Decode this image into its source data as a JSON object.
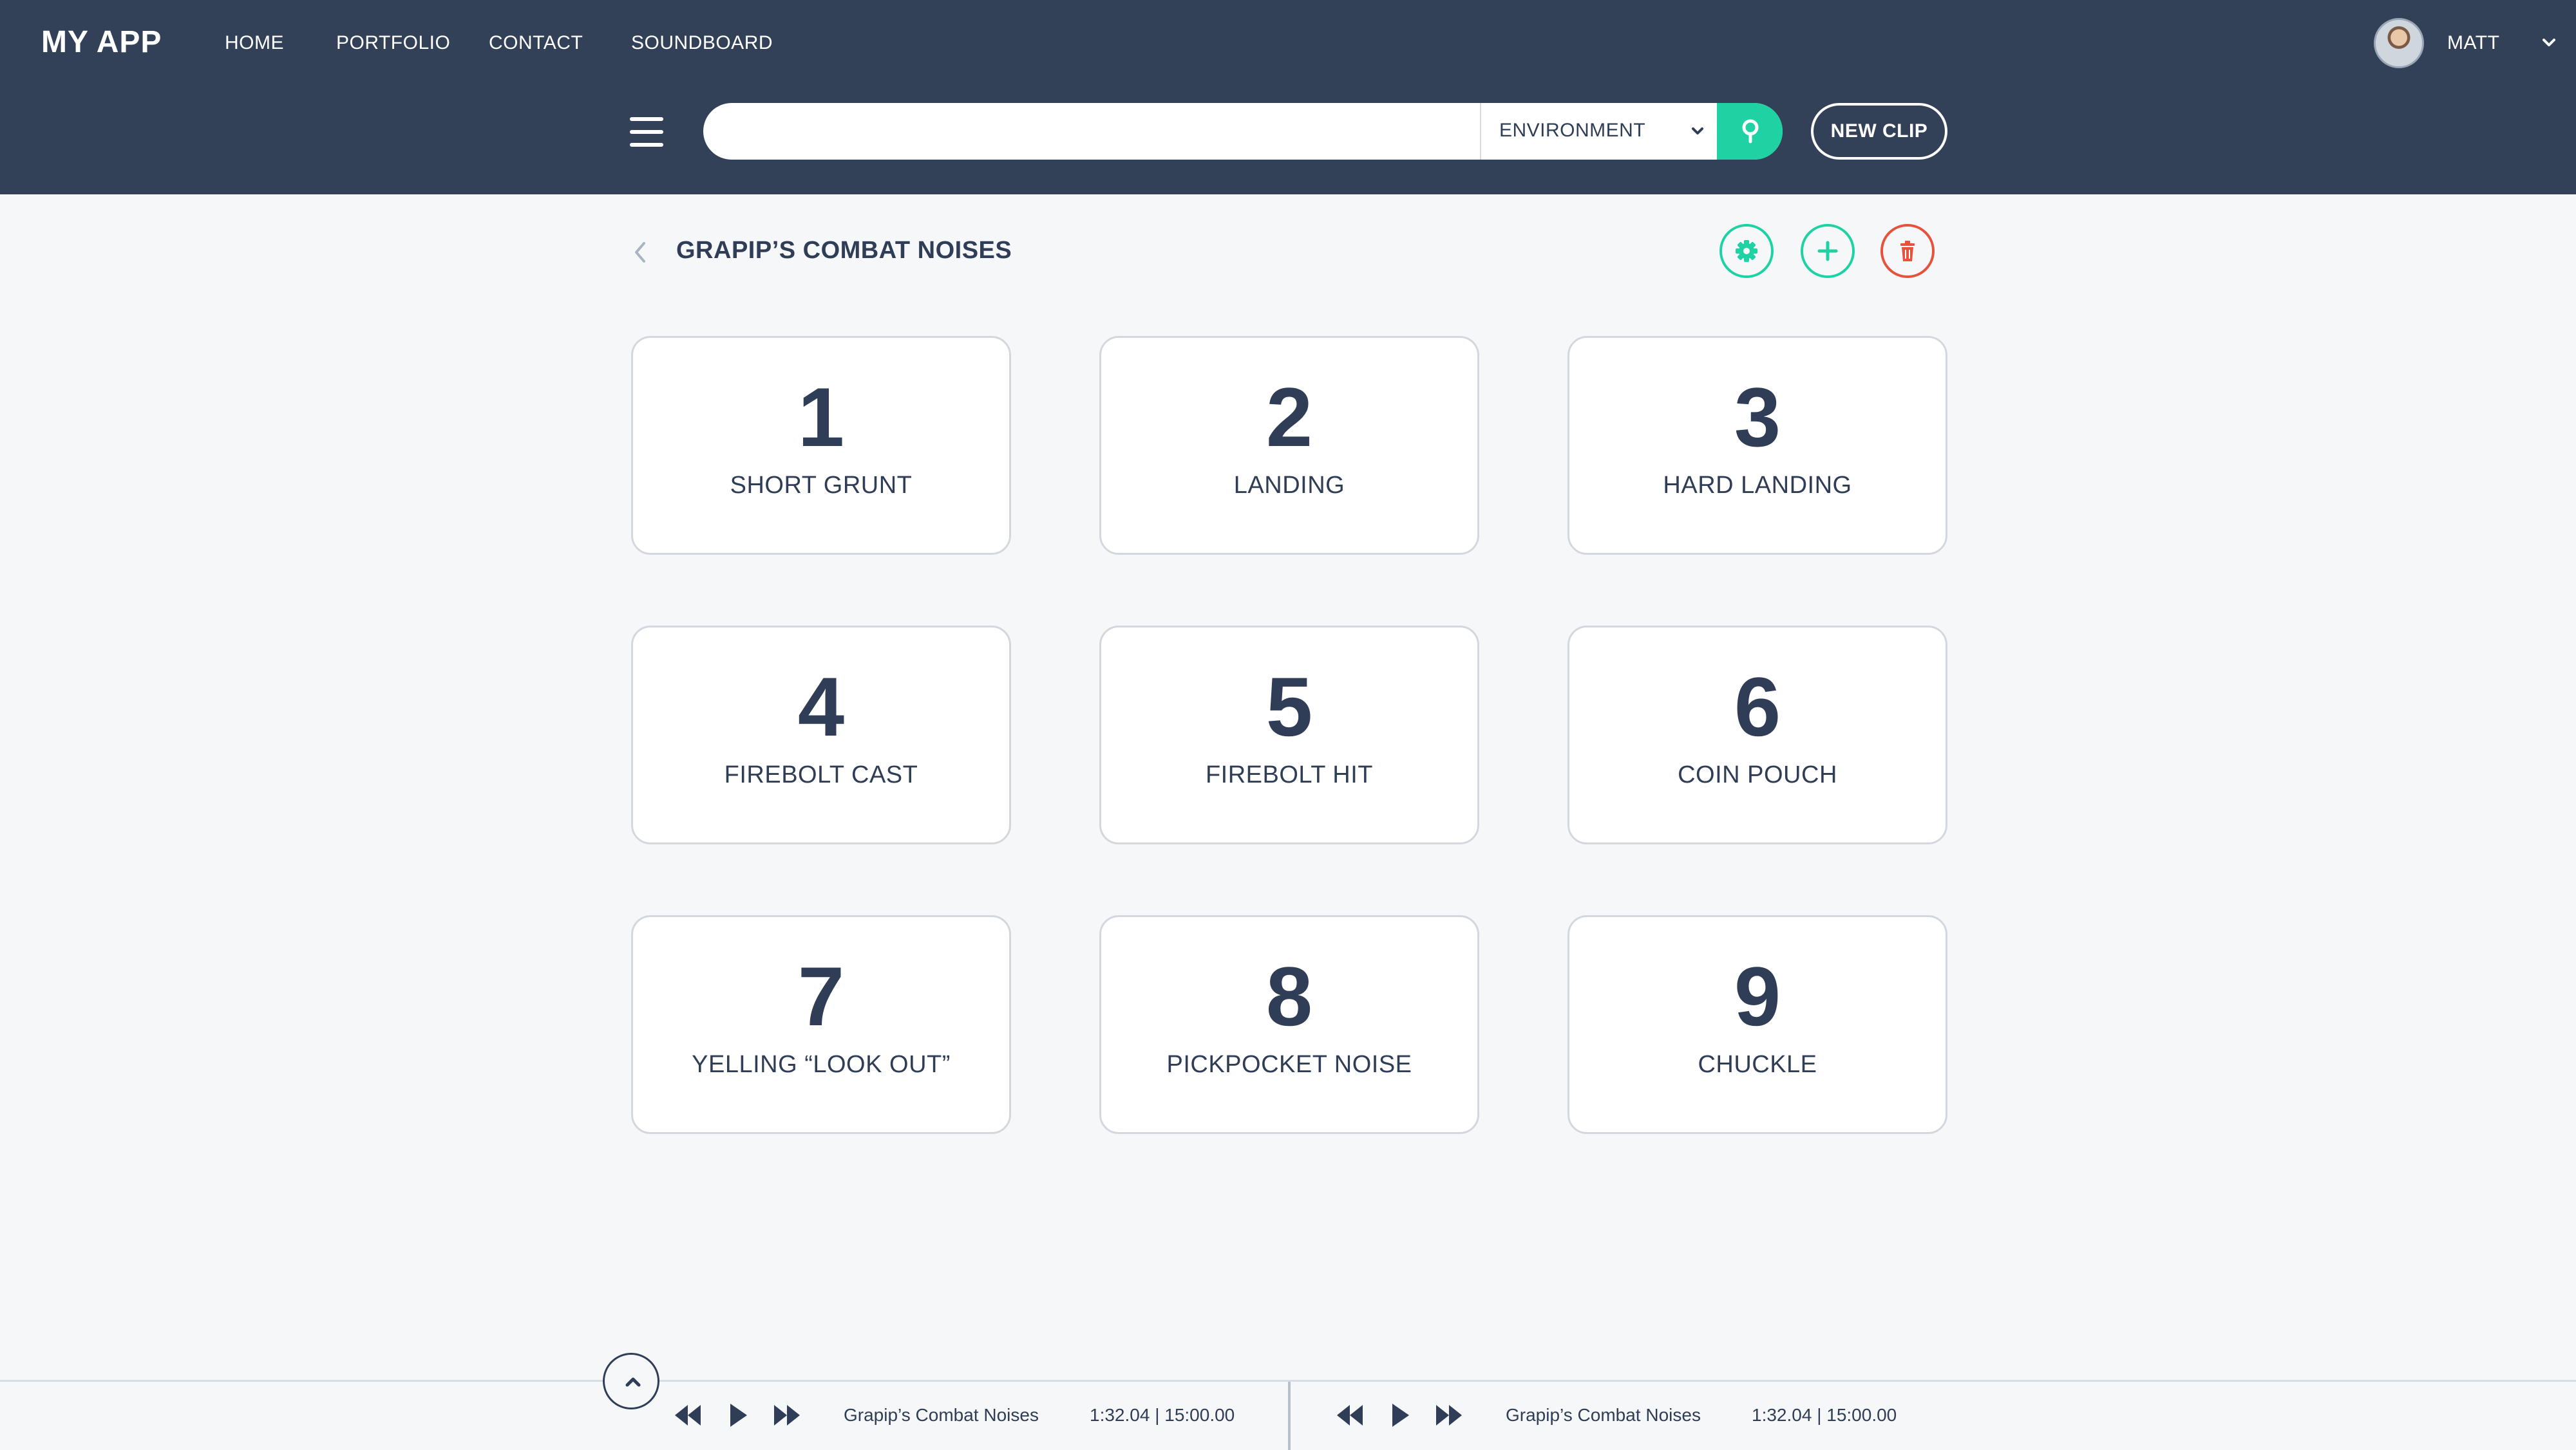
{
  "app": {
    "title": "MY APP"
  },
  "nav": {
    "items": [
      "HOME",
      "PORTFOLIO",
      "CONTACT",
      "SOUNDBOARD"
    ]
  },
  "user": {
    "name": "MATT"
  },
  "search": {
    "value": "",
    "placeholder": "",
    "category": "ENVIRONMENT",
    "new_clip_label": "NEW CLIP"
  },
  "board": {
    "title": "GRAPIP’S COMBAT NOISES",
    "tiles": [
      {
        "number": "1",
        "label": "SHORT GRUNT"
      },
      {
        "number": "2",
        "label": "LANDING"
      },
      {
        "number": "3",
        "label": "HARD LANDING"
      },
      {
        "number": "4",
        "label": "FIREBOLT CAST"
      },
      {
        "number": "5",
        "label": "FIREBOLT HIT"
      },
      {
        "number": "6",
        "label": "COIN POUCH"
      },
      {
        "number": "7",
        "label": "YELLING “LOOK OUT”"
      },
      {
        "number": "8",
        "label": "PICKPOCKET NOISE"
      },
      {
        "number": "9",
        "label": "CHUCKLE"
      }
    ]
  },
  "players": [
    {
      "track": "Grapip’s Combat Noises",
      "time": "1:32.04 | 15:00.00"
    },
    {
      "track": "Grapip’s Combat Noises",
      "time": "1:32.04 | 15:00.00"
    }
  ],
  "colors": {
    "header_bg": "#334158",
    "accent": "#1ed2a3",
    "danger": "#e6523b",
    "text": "#2f3d56",
    "page_bg": "#f6f7f9"
  },
  "icons": {
    "menu": "hamburger-menu-icon",
    "search": "search-icon",
    "back": "chevron-left-icon",
    "settings": "gear-icon",
    "add": "plus-icon",
    "delete": "trash-icon",
    "collapse": "chevron-up-icon",
    "rewind": "rewind-icon",
    "play": "play-icon",
    "fast_forward": "fast-forward-icon"
  }
}
